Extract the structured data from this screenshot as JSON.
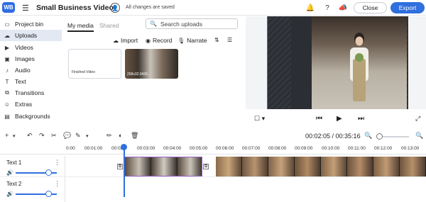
{
  "header": {
    "logo_text": "WB",
    "project_title": "Small Business Video",
    "save_status": "All changes are saved",
    "close_label": "Close",
    "export_label": "Export",
    "icons": [
      "menu-icon",
      "user-share-icon",
      "bell-icon",
      "help-icon",
      "megaphone-icon"
    ]
  },
  "sidebar": {
    "items": [
      {
        "label": "Project bin",
        "icon": "folder-icon",
        "active": false
      },
      {
        "label": "Uploads",
        "icon": "upload-icon",
        "active": true
      },
      {
        "label": "Videos",
        "icon": "video-icon",
        "active": false
      },
      {
        "label": "Images",
        "icon": "image-icon",
        "active": false
      },
      {
        "label": "Audio",
        "icon": "music-icon",
        "active": false
      },
      {
        "label": "Text",
        "icon": "text-icon",
        "active": false
      },
      {
        "label": "Transitions",
        "icon": "transitions-icon",
        "active": false
      },
      {
        "label": "Extras",
        "icon": "extras-icon",
        "active": false
      },
      {
        "label": "Backgrounds",
        "icon": "backgrounds-icon",
        "active": false
      }
    ]
  },
  "media": {
    "tabs": [
      {
        "label": "My media",
        "active": true
      },
      {
        "label": "Shared",
        "active": false
      }
    ],
    "search_placeholder": "Search uploads",
    "actions": {
      "import": "Import",
      "record": "Record",
      "narrate": "Narrate"
    },
    "items": [
      {
        "label": "Finished Video",
        "kind": "folder"
      },
      {
        "label": "258x32.0426...",
        "kind": "video-thumbnail"
      }
    ]
  },
  "timeline": {
    "timecode": "00:02:05 / 00:35:16",
    "ruler_ticks": [
      "0:00",
      "00:01:00",
      "00:02",
      "00:03:00",
      "00:04:00",
      "00:05:00",
      "00:06:00",
      "00:07:00",
      "00:08:00",
      "00:09:00",
      "00:10:00",
      "00:11:00",
      "00:12:00",
      "00:13:00"
    ],
    "tracks": [
      {
        "name": "Text 1"
      },
      {
        "name": "Text 2"
      }
    ]
  },
  "colors": {
    "accent": "#2f6fde",
    "selected_clip_border": "#9a63c9",
    "sidebar_active": "#e3e9f3"
  }
}
